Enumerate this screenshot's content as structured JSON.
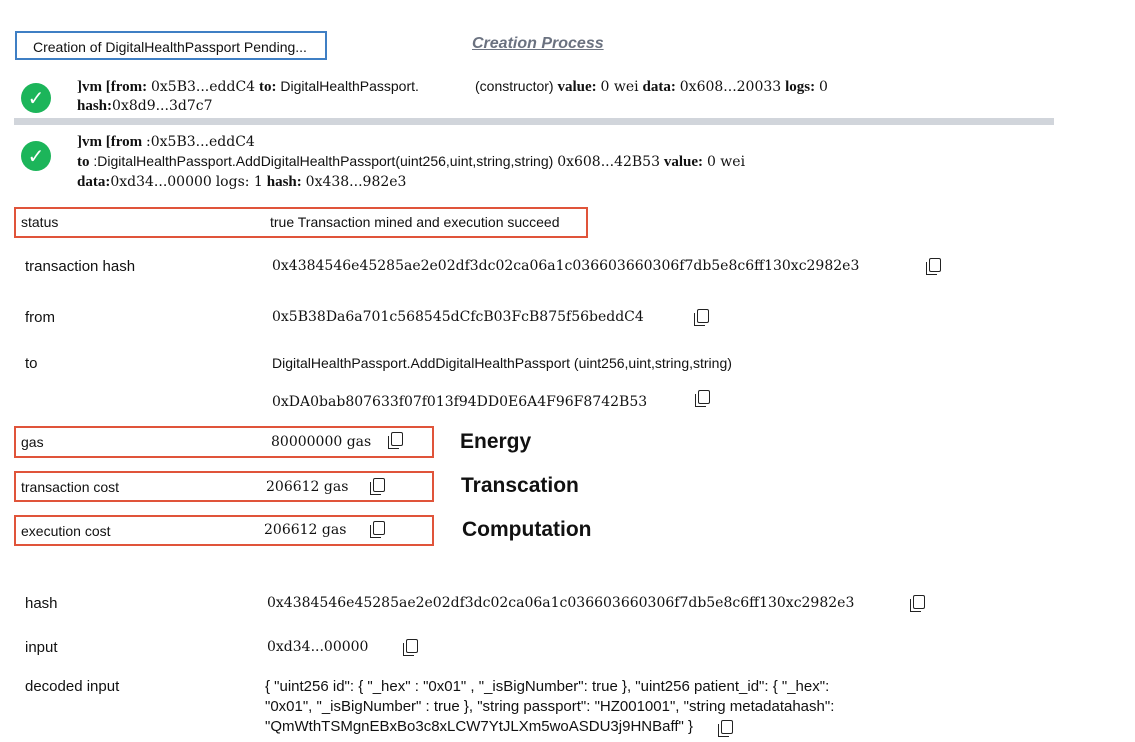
{
  "pending_label": "Creation of DigitalHealthPassport Pending...",
  "creation_process": "Creation Process",
  "tx1": {
    "prefix": "]vm [from:",
    "from": "0x5B3...eddC4",
    "to_label": "to:",
    "to": "DigitalHealthPassport.",
    "constructor": "(constructor)",
    "value_label": "value:",
    "value": "0 wei",
    "data_label": "data:",
    "data": "0x608...20033",
    "logs_label": "logs:",
    "logs": "0",
    "hash_label": "hash:",
    "hash": "0x8d9...3d7c7"
  },
  "tx2": {
    "prefix": "]vm [from",
    "from": ":0x5B3...eddC4",
    "to_label": "to",
    "to": ":DigitalHealthPassport.AddDigitalHealthPassport(uint256,uint,string,string)",
    "to_addr": "0x608...42B53",
    "value_label": "value:",
    "value": "0 wei",
    "data_label": "data:",
    "data": "0xd34...00000",
    "logs": "logs: 1",
    "hash_label": "hash:",
    "hash": "0x438...982e3"
  },
  "details": {
    "status_label": "status",
    "status_value": "true Transaction mined and execution succeed",
    "tx_hash_label": "transaction hash",
    "tx_hash_value": "0x4384546e45285ae2e02df3dc02ca06a1c036603660306f7db5e8c6ff130xc2982e3",
    "from_label": "from",
    "from_value": "0x5B38Da6a701c568545dCfcB03FcB875f56beddC4",
    "to_label": "to",
    "to_value": "DigitalHealthPassport.AddDigitalHealthPassport (uint256,uint,string,string)",
    "to_address": "0xDA0bab807633f07f013f94DD0E6A4F96F8742B53",
    "gas_label": "gas",
    "gas_value": "80000000 gas",
    "tx_cost_label": "transaction cost",
    "tx_cost_value": "206612 gas",
    "exec_cost_label": "execution cost",
    "exec_cost_value": "206612 gas",
    "hash_label": "hash",
    "hash_value": "0x4384546e45285ae2e02df3dc02ca06a1c036603660306f7db5e8c6ff130xc2982e3",
    "input_label": "input",
    "input_value": "0xd34...00000",
    "decoded_label": "decoded input",
    "decoded_line1": "{   \"uint256 id\": { \"_hex\" : \"0x01\" , \"_isBigNumber\": true }, \"uint256 patient_id\": { \"_hex\":",
    "decoded_line2": "\"0x01\", \"_isBigNumber\" : true }, \"string passport\": \"HZ001001\", \"string metadatahash\":",
    "decoded_line3": "\"QmWthTSMgnEBxBo3c8xLCW7YtJLXm5woASDU3j9HNBaff\" }"
  },
  "annotations": {
    "energy": "Energy",
    "transaction": "Transcation",
    "computation": "Computation"
  },
  "colors": {
    "check_green": "#1cb55a",
    "box_red": "#e0543a",
    "box_blue": "#3f7fc4"
  }
}
